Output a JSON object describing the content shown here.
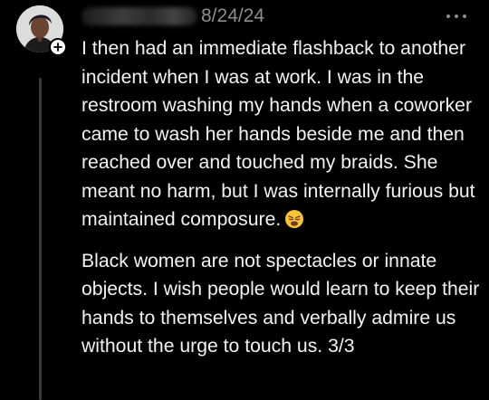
{
  "post": {
    "date": "8/24/24",
    "paragraphs": [
      "I then had an immediate flashback to another incident when I was at work. I was in the restroom washing my hands when a coworker came to wash her hands beside me and then reached over and touched my braids. She meant no harm, but I was internally furious but maintained composure.",
      "Black women are not spectacles or innate objects.  I wish people would learn to keep their hands to themselves and verbally admire us without the urge to touch us. 3/3"
    ],
    "icons": {
      "avatar": "profile-avatar",
      "follow": "plus-icon",
      "more": "more-horizontal-icon",
      "emoji": "weary-face-emoji"
    }
  },
  "colors": {
    "background": "#000000",
    "text": "#f2f2f2",
    "muted": "#8e8e8e",
    "thread_line": "#3a3a3a",
    "emoji_yellow": "#f9c23c"
  }
}
